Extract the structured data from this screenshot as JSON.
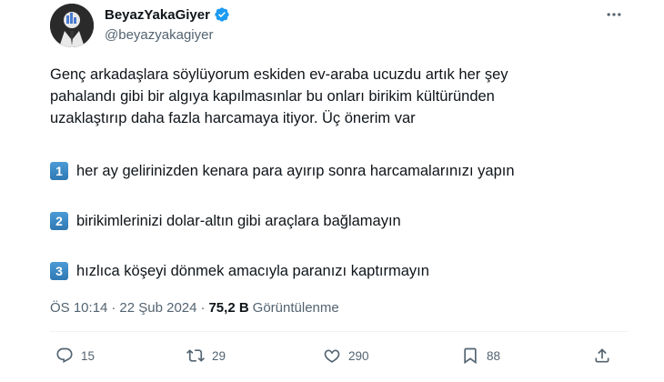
{
  "author": {
    "display_name": "BeyazYakaGiyer",
    "handle": "@beyazyakagiyer",
    "verified": true
  },
  "tweet": {
    "intro_lines": [
      "Genç arkadaşlara söylüyorum eskiden ev-araba ucuzdu artık her şey",
      "pahalandı gibi bir algıya kapılmasınlar bu onları birikim kültüründen",
      "uzaklaştırıp daha fazla harcamaya itiyor. Üç önerim var"
    ],
    "items": [
      {
        "num": "1",
        "text": "her ay gelirinizden kenara para ayırıp sonra harcamalarınızı yapın"
      },
      {
        "num": "2",
        "text": "birikimlerinizi dolar-altın gibi araçlara bağlamayın"
      },
      {
        "num": "3",
        "text": "hızlıca köşeyi dönmek amacıyla paranızı kaptırmayın"
      }
    ]
  },
  "meta": {
    "time": "ÖS 10:14",
    "sep1": "·",
    "date": "22 Şub 2024",
    "sep2": "·",
    "views_count": "75,2 B",
    "views_label": "Görüntülenme"
  },
  "actions": {
    "reply_count": "15",
    "retweet_count": "29",
    "like_count": "290",
    "bookmark_count": "88"
  },
  "colors": {
    "verified": "#1d9bf0",
    "secondary_text": "#536471",
    "keycap": "#3b88c3"
  },
  "icons": [
    "verified-badge-icon",
    "more-icon",
    "reply-icon",
    "retweet-icon",
    "like-icon",
    "bookmark-icon",
    "share-icon"
  ]
}
